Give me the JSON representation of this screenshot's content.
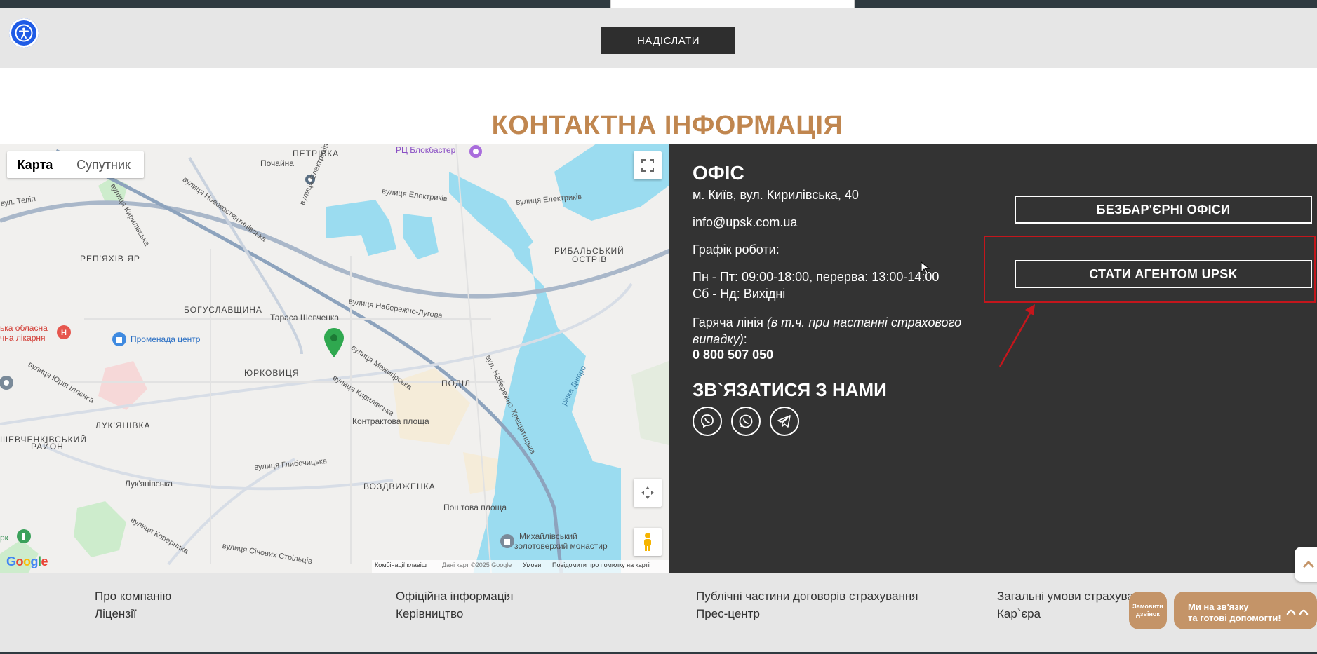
{
  "form": {
    "submit_label": "НАДІСЛАТИ"
  },
  "accessibility": {
    "icon": "accessibility-icon"
  },
  "section": {
    "title": "КОНТАКТНА ІНФОРМАЦІЯ"
  },
  "map": {
    "type_buttons": [
      "Карта",
      "Супутник"
    ],
    "districts": [
      "ПЕТРІВКА",
      "РЕП'ЯХІВ ЯР",
      "БОГУСЛАВЩИНА",
      "ЮРКОВИЦЯ",
      "ЛУК'ЯНІВКА",
      "ШЕВЧЕНКІВСЬКИЙ",
      "РАЙОН",
      "ПОДІЛ",
      "ВОЗДВИЖЕНКА",
      "РИБАЛЬСЬКИЙ",
      "ОСТРІВ"
    ],
    "places": [
      "Почайна",
      "РЦ Блокбастер",
      "Тараса Шевченка",
      "Промeнада центр",
      "Контрактова площа",
      "Лук'янівська",
      "Поштова площа",
      "Михайлівський",
      "золотоверхий монастир",
      "ька обласна",
      "чна лікарня",
      "рк"
    ],
    "streets": [
      "вулиця Новокостянтинівська",
      "вулиця Електриків",
      "вулиця Електриків",
      "вулиця Електриків",
      "вулиця Набережно-Лугова",
      "вулиця Межигірська",
      "вулиця Кирилівська",
      "вул. Набережно-Хрещатицька",
      "річка Дніпро",
      "вулиця Юрія Іллєнка",
      "вулиця Глибочицька",
      "вулиця Коперника",
      "вулиця Січових Стрільців",
      "вул. Телігі",
      "вулиця Кирилівська"
    ],
    "footer": [
      "Комбінації клавіш",
      "Дані карт ©2025 Google",
      "Умови",
      "Повідомити про помилку на карті"
    ],
    "logo": "Google"
  },
  "office": {
    "title": "ОФІС",
    "address": "м. Київ, вул. Кирилівська, 40",
    "email": "info@upsk.com.ua",
    "schedule_label": "Графік роботи:",
    "schedule_weekdays": "Пн - Пт: 09:00-18:00, перерва: 13:00-14:00",
    "schedule_weekend": "Сб - Нд: Вихідні",
    "hotline_label": "Гаряча лінія ",
    "hotline_note": "(в т.ч. при настанні страхового випадку)",
    "hotline_colon": ":",
    "hotline_phone": "0 800 507 050"
  },
  "connect": {
    "title": "ЗВ`ЯЗАТИСЯ З НАМИ",
    "icons": [
      "viber-icon",
      "whatsapp-icon",
      "telegram-icon"
    ]
  },
  "buttons": {
    "barrier_free": "БЕЗБАР'ЄРНІ ОФІСИ",
    "become_agent": "СТАТИ АГЕНТОМ UPSK"
  },
  "footer": {
    "col1": [
      "Про компанію",
      "Ліцензії"
    ],
    "col2": [
      "Офіційна інформація",
      "Керівництво"
    ],
    "col3": [
      "Публічні частини договорів страхування",
      "Прес-центр"
    ],
    "col4": [
      "Загальні умови страхування",
      "Кар`єра"
    ]
  },
  "widgets": {
    "callback": "Замовити дзвінок",
    "help_line1": "Ми на зв'язку",
    "help_line2": "та готові допомогти!"
  },
  "colors": {
    "accent": "#c0864f",
    "panel": "#333333",
    "highlight": "#c4161c",
    "a11y": "#1e5be6",
    "water": "#9bdcf0"
  }
}
